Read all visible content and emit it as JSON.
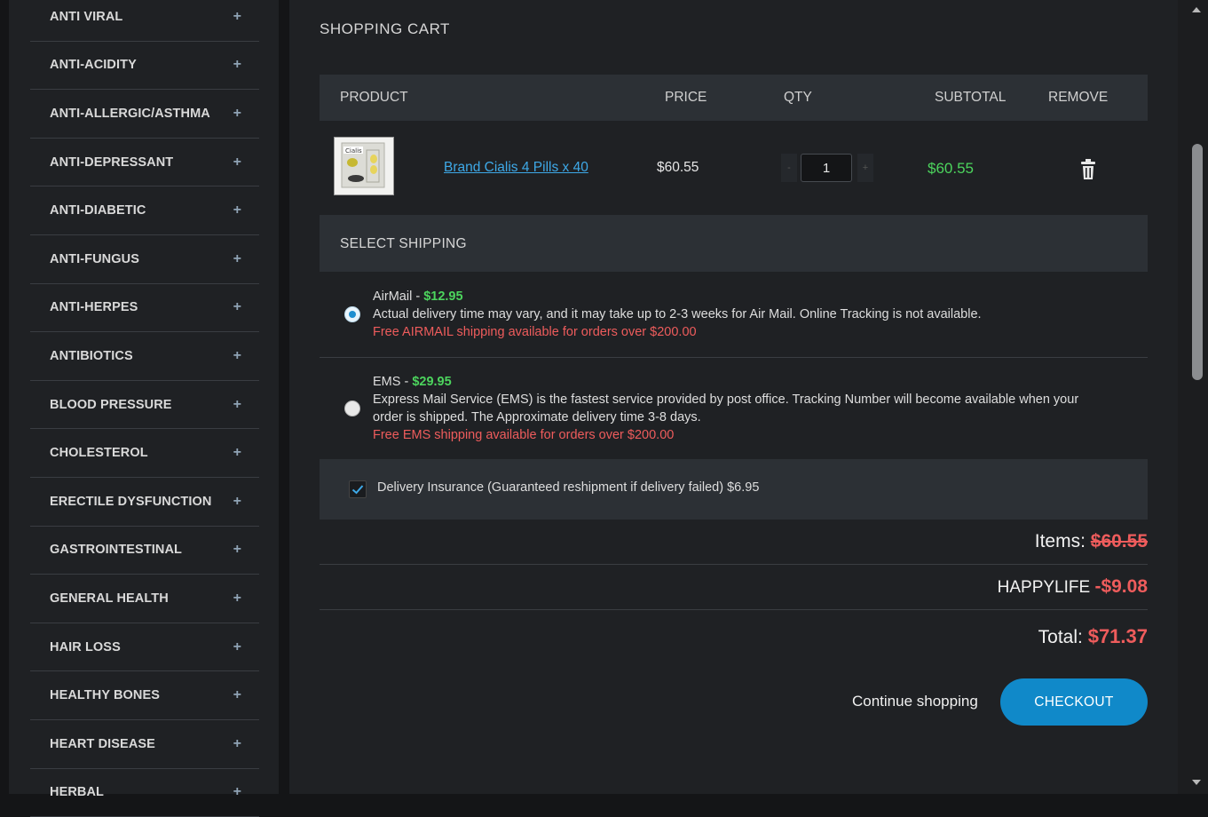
{
  "sidebar": {
    "categories": [
      {
        "label": "ANTI VIRAL"
      },
      {
        "label": "ANTI-ACIDITY"
      },
      {
        "label": "ANTI-ALLERGIC/ASTHMA"
      },
      {
        "label": "ANTI-DEPRESSANT"
      },
      {
        "label": "ANTI-DIABETIC"
      },
      {
        "label": "ANTI-FUNGUS"
      },
      {
        "label": "ANTI-HERPES"
      },
      {
        "label": "ANTIBIOTICS"
      },
      {
        "label": "BLOOD PRESSURE"
      },
      {
        "label": "CHOLESTEROL"
      },
      {
        "label": "ERECTILE DYSFUNCTION"
      },
      {
        "label": "GASTROINTESTINAL"
      },
      {
        "label": "GENERAL HEALTH"
      },
      {
        "label": "HAIR LOSS"
      },
      {
        "label": "HEALTHY BONES"
      },
      {
        "label": "HEART DISEASE"
      },
      {
        "label": "HERBAL"
      }
    ],
    "expand_symbol": "+"
  },
  "cart": {
    "title": "SHOPPING CART",
    "columns": {
      "product": "PRODUCT",
      "price": "PRICE",
      "qty": "QTY",
      "subtotal": "SUBTOTAL",
      "remove": "REMOVE"
    },
    "items": [
      {
        "name": "Brand Cialis 4 Pills x 40",
        "price": "$60.55",
        "qty": "1",
        "subtotal": "$60.55",
        "qty_minus": "-",
        "qty_plus": "+",
        "image_icon": "pill-box-thumbnail"
      }
    ]
  },
  "shipping": {
    "title": "SELECT SHIPPING",
    "options": [
      {
        "name": "AirMail - ",
        "price": "$12.95",
        "selected": true,
        "description": "Actual delivery time may vary, and it may take up to 2-3 weeks for Air Mail. Online Tracking is not available.",
        "free_note": "Free AIRMAIL shipping available for orders over $200.00"
      },
      {
        "name": "EMS - ",
        "price": "$29.95",
        "selected": false,
        "description_line1": "Express Mail Service (EMS) is the fastest service provided by post office. Tracking Number will become available when your",
        "description_line2": "order is shipped. The Approximate delivery time 3-8 days.",
        "free_note": "Free EMS shipping available for orders over $200.00"
      }
    ],
    "insurance": {
      "checked": true,
      "label": "Delivery Insurance (Guaranteed reshipment if delivery failed) $6.95"
    }
  },
  "totals": {
    "items_label": "Items: ",
    "items_value": "$60.55",
    "coupon_code": "HAPPYLIFE ",
    "discount": "-$9.08",
    "total_label": "Total: ",
    "total_value": "$71.37"
  },
  "actions": {
    "continue_label": "Continue shopping",
    "checkout_label": "CHECKOUT"
  },
  "colors": {
    "accent": "#1089c9",
    "green": "#4cd45d",
    "red": "#ee5c5c",
    "link": "#3ea9e8"
  }
}
